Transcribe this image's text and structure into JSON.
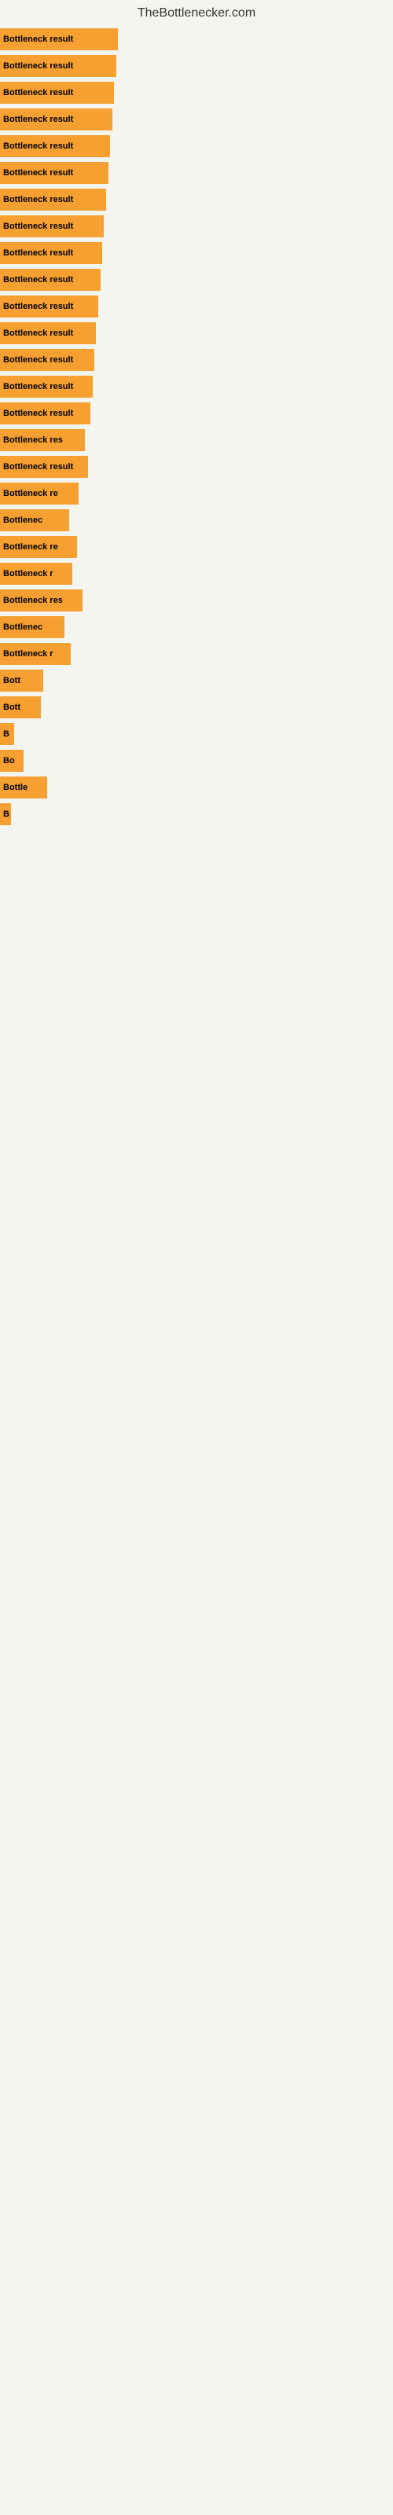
{
  "header": {
    "title": "TheBottlenecker.com"
  },
  "bars": [
    {
      "label": "Bottleneck result",
      "width": 150
    },
    {
      "label": "Bottleneck result",
      "width": 148
    },
    {
      "label": "Bottleneck result",
      "width": 145
    },
    {
      "label": "Bottleneck result",
      "width": 143
    },
    {
      "label": "Bottleneck result",
      "width": 140
    },
    {
      "label": "Bottleneck result",
      "width": 138
    },
    {
      "label": "Bottleneck result",
      "width": 135
    },
    {
      "label": "Bottleneck result",
      "width": 132
    },
    {
      "label": "Bottleneck result",
      "width": 130
    },
    {
      "label": "Bottleneck result",
      "width": 128
    },
    {
      "label": "Bottleneck result",
      "width": 125
    },
    {
      "label": "Bottleneck result",
      "width": 122
    },
    {
      "label": "Bottleneck result",
      "width": 120
    },
    {
      "label": "Bottleneck result",
      "width": 118
    },
    {
      "label": "Bottleneck result",
      "width": 115
    },
    {
      "label": "Bottleneck res",
      "width": 108
    },
    {
      "label": "Bottleneck result",
      "width": 112
    },
    {
      "label": "Bottleneck re",
      "width": 100
    },
    {
      "label": "Bottlenec",
      "width": 88
    },
    {
      "label": "Bottleneck re",
      "width": 98
    },
    {
      "label": "Bottleneck r",
      "width": 92
    },
    {
      "label": "Bottleneck res",
      "width": 105
    },
    {
      "label": "Bottlenec",
      "width": 82
    },
    {
      "label": "Bottleneck r",
      "width": 90
    },
    {
      "label": "Bott",
      "width": 55
    },
    {
      "label": "Bott",
      "width": 52
    },
    {
      "label": "B",
      "width": 18
    },
    {
      "label": "Bo",
      "width": 30
    },
    {
      "label": "Bottle",
      "width": 60
    },
    {
      "label": "B",
      "width": 14
    }
  ]
}
